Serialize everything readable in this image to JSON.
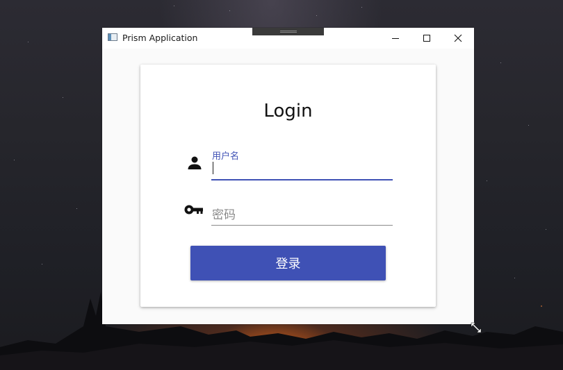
{
  "window": {
    "title": "Prism Application"
  },
  "login": {
    "heading": "Login",
    "username_label": "用户名",
    "password_placeholder": "密码",
    "submit_label": "登录"
  },
  "colors": {
    "accent": "#3f51b5",
    "window_background": "#fafafa"
  },
  "icons": [
    "app-icon",
    "drag-handle-icon",
    "minimize-icon",
    "maximize-icon",
    "close-icon",
    "user-icon",
    "key-icon",
    "resize-cursor-icon"
  ]
}
